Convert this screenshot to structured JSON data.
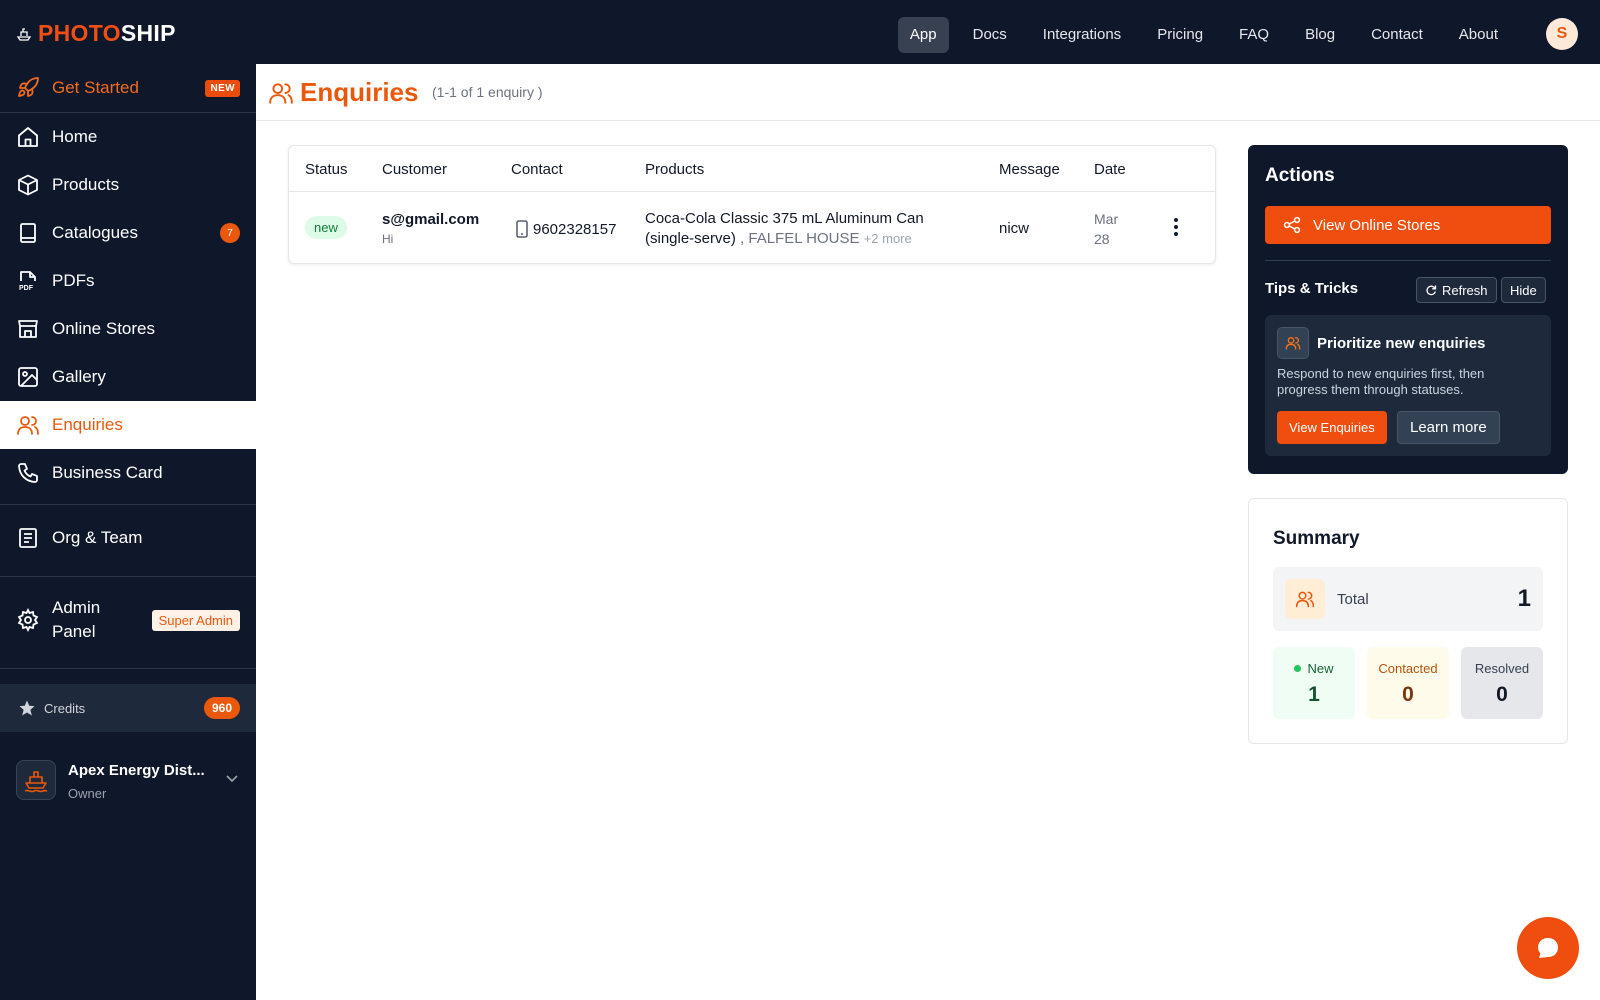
{
  "brand": {
    "part1": "PHOTO",
    "part2": "SHIP"
  },
  "nav": [
    "App",
    "Docs",
    "Integrations",
    "Pricing",
    "FAQ",
    "Blog",
    "Contact",
    "About"
  ],
  "user": {
    "initial": "S"
  },
  "sidebar": {
    "get_started": {
      "label": "Get Started",
      "badge": "NEW"
    },
    "home": "Home",
    "products": "Products",
    "catalogues": {
      "label": "Catalogues",
      "count": "7"
    },
    "pdfs": "PDFs",
    "online_stores": "Online Stores",
    "gallery": "Gallery",
    "enquiries": "Enquiries",
    "business_card": "Business Card",
    "org_team": "Org & Team",
    "admin_panel": {
      "label_line1": "Admin",
      "label_line2": "Panel",
      "badge": "Super Admin"
    },
    "credits": {
      "label": "Credits",
      "count": "960"
    },
    "org": {
      "name": "Apex Energy Dist...",
      "role": "Owner"
    }
  },
  "page": {
    "title": "Enquiries",
    "count_text": "(1-1 of 1 enquiry )"
  },
  "table": {
    "headers": {
      "status": "Status",
      "customer": "Customer",
      "contact": "Contact",
      "products": "Products",
      "message": "Message",
      "date": "Date"
    },
    "rows": [
      {
        "status": "new",
        "email": "s@gmail.com",
        "customer_message": "Hi",
        "phone": "9602328157",
        "product": "Coca-Cola Classic 375 mL Aluminum Can (single-serve)",
        "store": ", FALFEL HOUSE",
        "more": "+2 more",
        "message": "nicw",
        "date_line1": "Mar",
        "date_line2": "28"
      }
    ]
  },
  "actions": {
    "title": "Actions",
    "view_online_stores": "View Online Stores",
    "tips_title": "Tips & Tricks",
    "refresh": "Refresh",
    "hide": "Hide",
    "tip": {
      "title": "Prioritize new enquiries",
      "text": "Respond to new enquiries first, then progress them through statuses.",
      "primary": "View Enquiries",
      "secondary": "Learn more"
    }
  },
  "summary": {
    "title": "Summary",
    "total_label": "Total",
    "total_value": "1",
    "new_label": "New",
    "new_value": "1",
    "contacted_label": "Contacted",
    "contacted_value": "0",
    "resolved_label": "Resolved",
    "resolved_value": "0"
  },
  "colors": {
    "accent": "#ea580c",
    "sidebar_bg": "#0f172a",
    "status_new": "#22c55e"
  }
}
